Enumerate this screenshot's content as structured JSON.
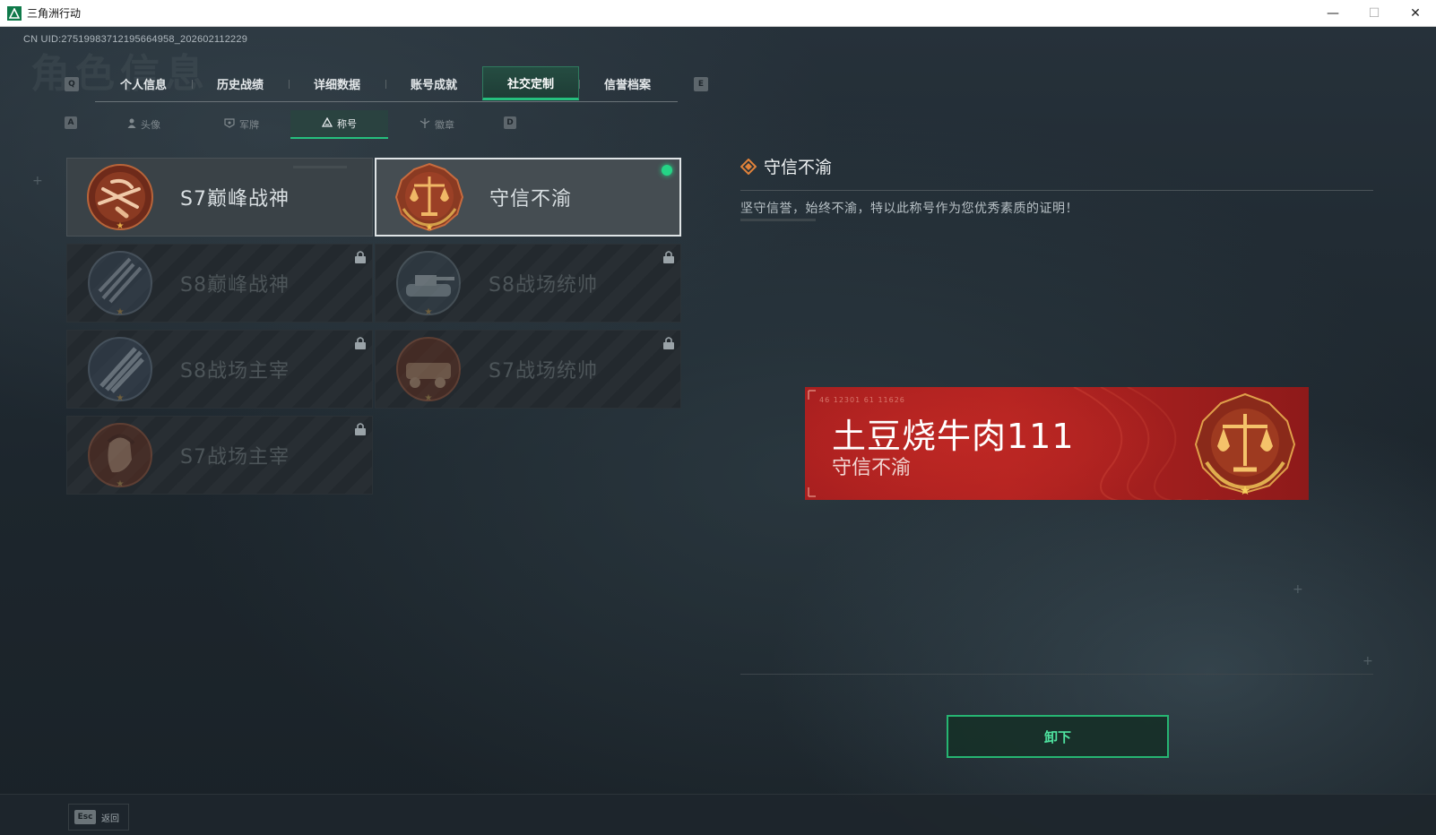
{
  "window": {
    "title": "三角洲行动",
    "minimize": "—",
    "maximize": "☐",
    "close": "✕"
  },
  "uid_text": "CN UID:275199837121956649​58_202602112229",
  "ghost_heading": "角色信息",
  "keys": {
    "prev_tab": "Q",
    "next_tab": "E",
    "prev_sub": "A",
    "next_sub": "D"
  },
  "main_tabs": [
    {
      "label": "个人信息",
      "active": false
    },
    {
      "label": "历史战绩",
      "active": false
    },
    {
      "label": "详细数据",
      "active": false
    },
    {
      "label": "账号成就",
      "active": false
    },
    {
      "label": "社交定制",
      "active": true
    },
    {
      "label": "信誉档案",
      "active": false
    }
  ],
  "sub_tabs": [
    {
      "label": "头像",
      "icon": "person-icon",
      "active": false
    },
    {
      "label": "军牌",
      "icon": "dogtag-icon",
      "active": false
    },
    {
      "label": "称号",
      "icon": "title-icon",
      "active": true
    },
    {
      "label": "徽章",
      "icon": "badge-icon",
      "active": false
    }
  ],
  "titles": [
    {
      "name": "S7巅峰战神",
      "state": "unlocked",
      "emblem": "crossbow-emblem-icon"
    },
    {
      "name": "守信不渝",
      "state": "selected",
      "emblem": "scales-emblem-icon"
    },
    {
      "name": "S8巅峰战神",
      "state": "locked",
      "emblem": "rifles-emblem-icon"
    },
    {
      "name": "S8战场统帅",
      "state": "locked",
      "emblem": "tank-emblem-icon"
    },
    {
      "name": "S8战场主宰",
      "state": "locked",
      "emblem": "missile-emblem-icon"
    },
    {
      "name": "S7战场统帅",
      "state": "locked",
      "emblem": "armored-car-emblem-icon"
    },
    {
      "name": "S7战场主宰",
      "state": "locked",
      "emblem": "soldier-emblem-icon"
    }
  ],
  "detail": {
    "title": "守信不渝",
    "description": "坚守信誉，始终不渝，特以此称号作为您优秀素质的证明！"
  },
  "banner": {
    "player_name": "土豆烧牛肉111",
    "title": "守信不渝",
    "code": "46 12301  61 11626"
  },
  "action_button": "卸下",
  "footer": {
    "esc_key": "Esc",
    "back_label": "返回"
  },
  "colors": {
    "accent": "#25c07e",
    "banner_red": "#b32321",
    "emblem_gold": "#d99a3c",
    "emblem_bronze": "#8a3a22"
  }
}
